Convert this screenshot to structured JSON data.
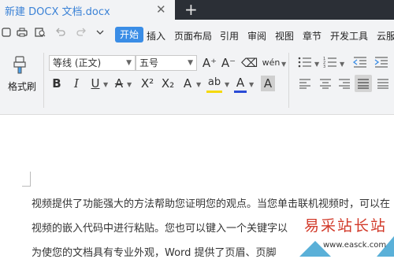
{
  "tab": {
    "title": "新建 DOCX 文档.docx",
    "close": "✕",
    "new_tab": "+"
  },
  "quick_access": {
    "icons": [
      "new-file-icon",
      "print-icon",
      "print-preview-icon",
      "undo-icon",
      "redo-icon",
      "customize-arrow-icon"
    ]
  },
  "menu": {
    "items": [
      "开始",
      "插入",
      "页面布局",
      "引用",
      "审阅",
      "视图",
      "章节",
      "开发工具",
      "云服"
    ],
    "active": "开始"
  },
  "toolbar": {
    "format_painter_label": "格式刷",
    "font_name": "等线 (正文)",
    "font_size": "五号",
    "grow_font": "A⁺",
    "shrink_font": "A⁻",
    "clear_format_glyph": "⌫",
    "phonetic_glyph": "wén",
    "bold": "B",
    "italic": "I",
    "underline": "U",
    "strikethrough": "A",
    "superscript": "X²",
    "subscript": "X₂",
    "text_effect": "A",
    "highlight": "ab",
    "font_color": "A",
    "char_shading": "A"
  },
  "colors": {
    "accent": "#3a8de6",
    "titlebar": "#2b2f36",
    "ribbon": "#f2f3f5",
    "highlight_yellow": "#f5d90a",
    "font_red": "#2a4bd6"
  },
  "document": {
    "lines": [
      "视频提供了功能强大的方法帮助您证明您的观点。当您单击联机视频时，可以在",
      "视频的嵌入代码中进行粘贴。您也可以键入一个关键字以",
      "为使您的文档具有专业外观，Word 提供了页眉、页脚"
    ]
  },
  "watermark": {
    "text": "易采站长站",
    "url": "www.easck.com"
  }
}
